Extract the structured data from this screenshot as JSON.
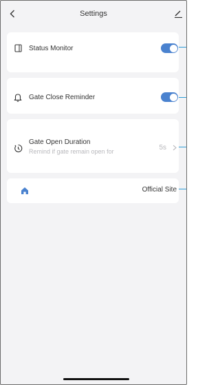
{
  "header": {
    "title": "Settings",
    "back_icon": "chevron-left-icon",
    "edit_icon": "pencil-icon"
  },
  "settings": {
    "status_monitor": {
      "label": "Status Monitor",
      "icon": "device-icon",
      "enabled": true
    },
    "gate_close_reminder": {
      "label": "Gate Close Reminder",
      "icon": "bell-icon",
      "enabled": true
    },
    "gate_open_duration": {
      "label": "Gate Open Duration",
      "sublabel": "Remind if gate remain open for",
      "value": "5s",
      "icon": "timer-icon"
    },
    "official_site": {
      "label": "Official Site",
      "icon": "home-icon"
    }
  },
  "colors": {
    "accent": "#4a82cf",
    "connector": "#2b9bd6",
    "background": "#f3f3f5",
    "card": "#ffffff"
  }
}
